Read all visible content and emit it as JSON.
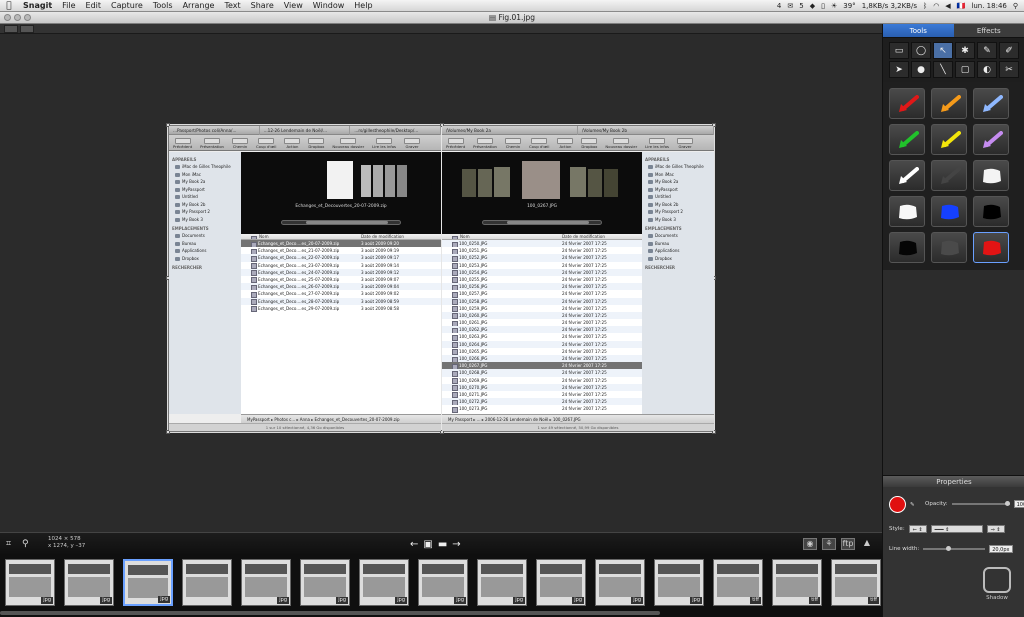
{
  "menubar": {
    "app_name": "Snagit",
    "items": [
      "File",
      "Edit",
      "Capture",
      "Tools",
      "Arrange",
      "Text",
      "Share",
      "View",
      "Window",
      "Help"
    ],
    "status": {
      "temp": "39°",
      "net": "1,8KB/s 3,2KB/s",
      "cpu_time": "4",
      "count": "5",
      "flag": "🇫🇷",
      "clock": "lun. 18:46"
    }
  },
  "window": {
    "title": "Fig.01.jpg"
  },
  "capture": {
    "left_finder": {
      "tabs": [
        "...Passport/Photos coli/Anna/...",
        "...12-26 Lendemain de Noël/...",
        "...rs/gillestheophile/Desktop/..."
      ],
      "toolbar": [
        "Précédent",
        "Présentation",
        "Chemin",
        "Coup d'œil",
        "Action",
        "Dropbox",
        "Nouveau dossier",
        "Lire les infos",
        "Graver"
      ],
      "sidebar": {
        "appareils_label": "APPAREILS",
        "devices": [
          "iMac de Gilles Theophile",
          "Mon iMac",
          "My Book 2a",
          "MyPassport",
          "Untitled",
          "My Book 2b",
          "My Passport 2",
          "My Book 3"
        ],
        "emplacements_label": "EMPLACEMENTS",
        "places": [
          "Documents",
          "Bureau",
          "Applications",
          "Dropbox"
        ],
        "recherche_label": "RECHERCHER"
      },
      "cover_caption": "Echanges_et_Decouvertes_20-07-2009.zip",
      "columns": [
        "Nom",
        "Date de modification"
      ],
      "rows": [
        {
          "name": "Echanges_et_Deco....es_20-07-2009.zip",
          "date": "3 août 2009 09:20"
        },
        {
          "name": "Echanges_et_Deco....es_21-07-2009.zip",
          "date": "3 août 2009 09:19"
        },
        {
          "name": "Echanges_et_Deco....es_22-07-2009.zip",
          "date": "3 août 2009 09:17"
        },
        {
          "name": "Echanges_et_Deco....es_23-07-2009.zip",
          "date": "3 août 2009 09:14"
        },
        {
          "name": "Echanges_et_Deco....es_24-07-2009.zip",
          "date": "3 août 2009 09:12"
        },
        {
          "name": "Echanges_et_Deco....es_25-07-2009.zip",
          "date": "3 août 2009 09:07"
        },
        {
          "name": "Echanges_et_Deco....es_26-07-2009.zip",
          "date": "3 août 2009 09:04"
        },
        {
          "name": "Echanges_et_Deco....es_27-07-2009.zip",
          "date": "3 août 2009 09:02"
        },
        {
          "name": "Echanges_et_Deco....es_28-07-2009.zip",
          "date": "3 août 2009 08:59"
        },
        {
          "name": "Echanges_et_Deco....es_29-07-2009.zip",
          "date": "3 août 2009 08:58"
        }
      ],
      "path": "MyPassport ▸ Photos c... ▸ Anna ▸ Echanges_et_Decouvertes_20-07-2009.zip",
      "status": "1 sur 10 sélectionné, 4,36 Go disponibles"
    },
    "right_finder": {
      "tabs": [
        "/Volumes/My Book 2a",
        "/Volumes/My Book 2b"
      ],
      "toolbar": [
        "Précédent",
        "Présentation",
        "Chemin",
        "Coup d'œil",
        "Action",
        "Dropbox",
        "Nouveau dossier",
        "Lire les infos",
        "Graver"
      ],
      "sidebar": {
        "appareils_label": "APPAREILS",
        "devices": [
          "iMac de Gilles Theophile",
          "Mon iMac",
          "My Book 2a",
          "MyPassport",
          "Untitled",
          "My Book 2b",
          "My Passport 2",
          "My Book 3"
        ],
        "emplacements_label": "EMPLACEMENTS",
        "places": [
          "Documents",
          "Bureau",
          "Applications",
          "Dropbox"
        ],
        "recherche_label": "RECHERCHER"
      },
      "cover_caption": "100_0267.JPG",
      "columns": [
        "Nom",
        "Date de modification"
      ],
      "rows": [
        {
          "name": "100_0250.JPG",
          "date": "24 février 2007 17:25"
        },
        {
          "name": "100_0251.JPG",
          "date": "24 février 2007 17:25"
        },
        {
          "name": "100_0252.JPG",
          "date": "24 février 2007 17:25"
        },
        {
          "name": "100_0253.JPG",
          "date": "24 février 2007 17:25"
        },
        {
          "name": "100_0254.JPG",
          "date": "24 février 2007 17:25"
        },
        {
          "name": "100_0255.JPG",
          "date": "24 février 2007 17:25"
        },
        {
          "name": "100_0256.JPG",
          "date": "24 février 2007 17:25"
        },
        {
          "name": "100_0257.JPG",
          "date": "24 février 2007 17:25"
        },
        {
          "name": "100_0258.JPG",
          "date": "24 février 2007 17:25"
        },
        {
          "name": "100_0259.JPG",
          "date": "24 février 2007 17:25"
        },
        {
          "name": "100_0260.JPG",
          "date": "24 février 2007 17:25"
        },
        {
          "name": "100_0261.JPG",
          "date": "24 février 2007 17:25"
        },
        {
          "name": "100_0262.JPG",
          "date": "24 février 2007 17:25"
        },
        {
          "name": "100_0263.JPG",
          "date": "24 février 2007 17:25"
        },
        {
          "name": "100_0264.JPG",
          "date": "24 février 2007 17:25"
        },
        {
          "name": "100_0265.JPG",
          "date": "24 février 2007 17:25"
        },
        {
          "name": "100_0266.JPG",
          "date": "24 février 2007 17:25"
        },
        {
          "name": "100_0267.JPG",
          "date": "24 février 2007 17:25"
        },
        {
          "name": "100_0268.JPG",
          "date": "24 février 2007 17:25"
        },
        {
          "name": "100_0269.JPG",
          "date": "24 février 2007 17:25"
        },
        {
          "name": "100_0270.JPG",
          "date": "24 février 2007 17:25"
        },
        {
          "name": "100_0271.JPG",
          "date": "24 février 2007 17:25"
        },
        {
          "name": "100_0272.JPG",
          "date": "24 février 2007 17:25"
        },
        {
          "name": "100_0273.JPG",
          "date": "24 février 2007 17:25"
        }
      ],
      "selected_index": 17,
      "path": "My Passport ▸ ... ▸ 2006-12-26 Lendemain de Noël ▸ 100_0267.JPG",
      "status": "1 sur 49 sélectionné, 50,99 Go disponibles"
    }
  },
  "panel": {
    "tabs": [
      "Tools",
      "Effects"
    ],
    "tools": [
      {
        "name": "selection-tool-icon",
        "glyph": "▭"
      },
      {
        "name": "callout-tool-icon",
        "glyph": "◯"
      },
      {
        "name": "arrow-tool-icon",
        "glyph": "↖"
      },
      {
        "name": "stamp-tool-icon",
        "glyph": "✱"
      },
      {
        "name": "pen-tool-icon",
        "glyph": "✎"
      },
      {
        "name": "highlight-tool-icon",
        "glyph": "✐"
      },
      {
        "name": "cursor-tool-icon",
        "glyph": "➤"
      },
      {
        "name": "fill-tool-icon",
        "glyph": "●"
      },
      {
        "name": "line-tool-icon",
        "glyph": "╲"
      },
      {
        "name": "shape-tool-icon",
        "glyph": "▢"
      },
      {
        "name": "erase-tool-icon",
        "glyph": "◐"
      },
      {
        "name": "eraser-tool-icon",
        "glyph": "✂"
      }
    ],
    "style_colors": [
      "#e01818",
      "#f59a1a",
      "#8fb8ff",
      "#21c22b",
      "#f3e60b",
      "#c58cf0",
      "#ffffff",
      "#444444",
      "#f4f4f4",
      "#f8f8f8",
      "#1540ff",
      "#000000",
      "#050505",
      "#4a4a4a",
      "#e31414"
    ],
    "properties": {
      "title": "Properties",
      "opacity_label": "Opacity:",
      "opacity_value": "100%",
      "opacity": 1.0,
      "style_label": "Style:",
      "line_width_label": "Line width:",
      "line_width_value": "20,0px",
      "line_width_fraction": 0.4,
      "color": "#e01010",
      "shadow_label": "Shadow"
    }
  },
  "tray": {
    "info_size": "1024 × 578",
    "info_pos": "x 1274, y –37",
    "thumbs": [
      {
        "ext": "jpg"
      },
      {
        "ext": "jpg"
      },
      {
        "ext": "jpg"
      },
      {
        "ext": ""
      },
      {
        "ext": "jpg"
      },
      {
        "ext": "jpg"
      },
      {
        "ext": "jpg"
      },
      {
        "ext": "jpg"
      },
      {
        "ext": "jpg"
      },
      {
        "ext": "jpg"
      },
      {
        "ext": "jpg"
      },
      {
        "ext": "jpg"
      },
      {
        "ext": "tiff"
      },
      {
        "ext": "tiff"
      },
      {
        "ext": "tiff"
      }
    ],
    "selected_index": 2,
    "ftp_label": "ftp"
  }
}
